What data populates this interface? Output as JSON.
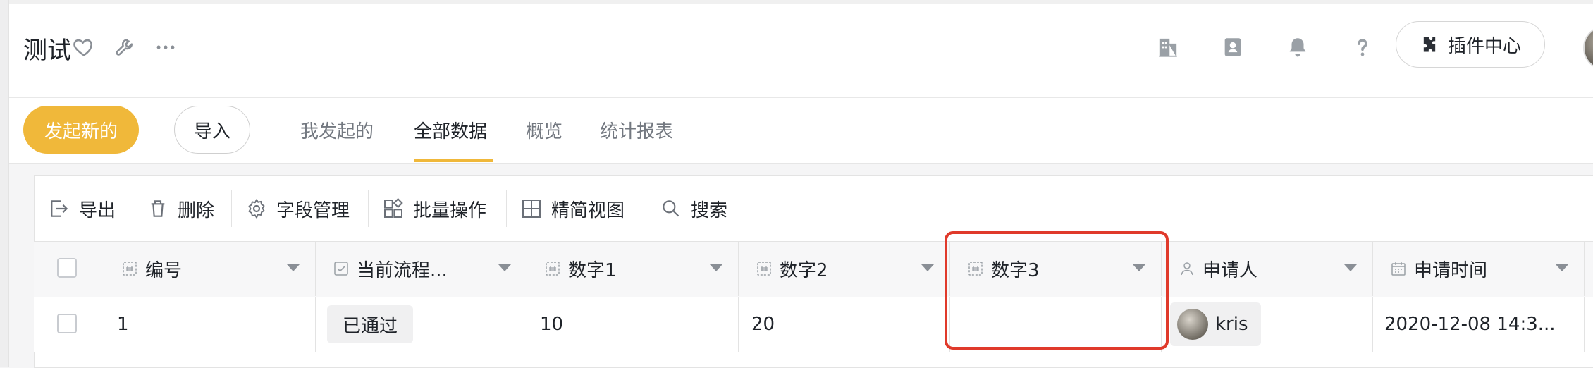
{
  "header": {
    "title": "测试",
    "plugin_center_label": "插件中心"
  },
  "actions": {
    "start_new_label": "发起新的",
    "import_label": "导入"
  },
  "tabs": [
    {
      "label": "我发起的",
      "active": false
    },
    {
      "label": "全部数据",
      "active": true
    },
    {
      "label": "概览",
      "active": false
    },
    {
      "label": "统计报表",
      "active": false
    }
  ],
  "toolbar": [
    {
      "label": "导出",
      "icon": "export-icon"
    },
    {
      "label": "删除",
      "icon": "trash-icon"
    },
    {
      "label": "字段管理",
      "icon": "gear-icon"
    },
    {
      "label": "批量操作",
      "icon": "batch-icon"
    },
    {
      "label": "精简视图",
      "icon": "grid-icon"
    },
    {
      "label": "搜索",
      "icon": "search-icon"
    }
  ],
  "table": {
    "columns": [
      {
        "label": "编号",
        "icon": "number-field-icon"
      },
      {
        "label": "当前流程...",
        "icon": "checkbox-field-icon"
      },
      {
        "label": "数字1",
        "icon": "number-field-icon"
      },
      {
        "label": "数字2",
        "icon": "number-field-icon"
      },
      {
        "label": "数字3",
        "icon": "number-field-icon"
      },
      {
        "label": "申请人",
        "icon": "person-icon"
      },
      {
        "label": "申请时间",
        "icon": "calendar-icon"
      }
    ],
    "rows": [
      {
        "id": "1",
        "status": "已通过",
        "num1": "10",
        "num2": "20",
        "num3": "",
        "applicant": "kris",
        "time": "2020-12-08 14:3..."
      }
    ]
  },
  "colors": {
    "accent": "#f0b83a",
    "highlight_border": "#e03a2b"
  }
}
